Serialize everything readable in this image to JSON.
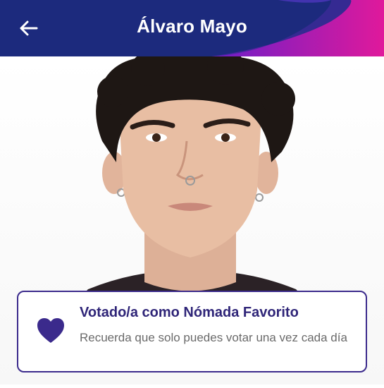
{
  "header": {
    "title": "Álvaro Mayo",
    "back_icon": "arrow-left-icon",
    "background_color": "#1c2a7d",
    "accent_colors": [
      "#6a1fc9",
      "#e0199b"
    ]
  },
  "photo": {
    "subject": "Álvaro Mayo",
    "hair_color": "#1e1714",
    "skin_color": "#e8bea3"
  },
  "vote_card": {
    "title": "Votado/a como Nómada Favorito",
    "message": "Recuerda que solo puedes votar una vez cada día",
    "icon": "heart-icon",
    "accent_color": "#3b2a8c",
    "voted": true
  }
}
